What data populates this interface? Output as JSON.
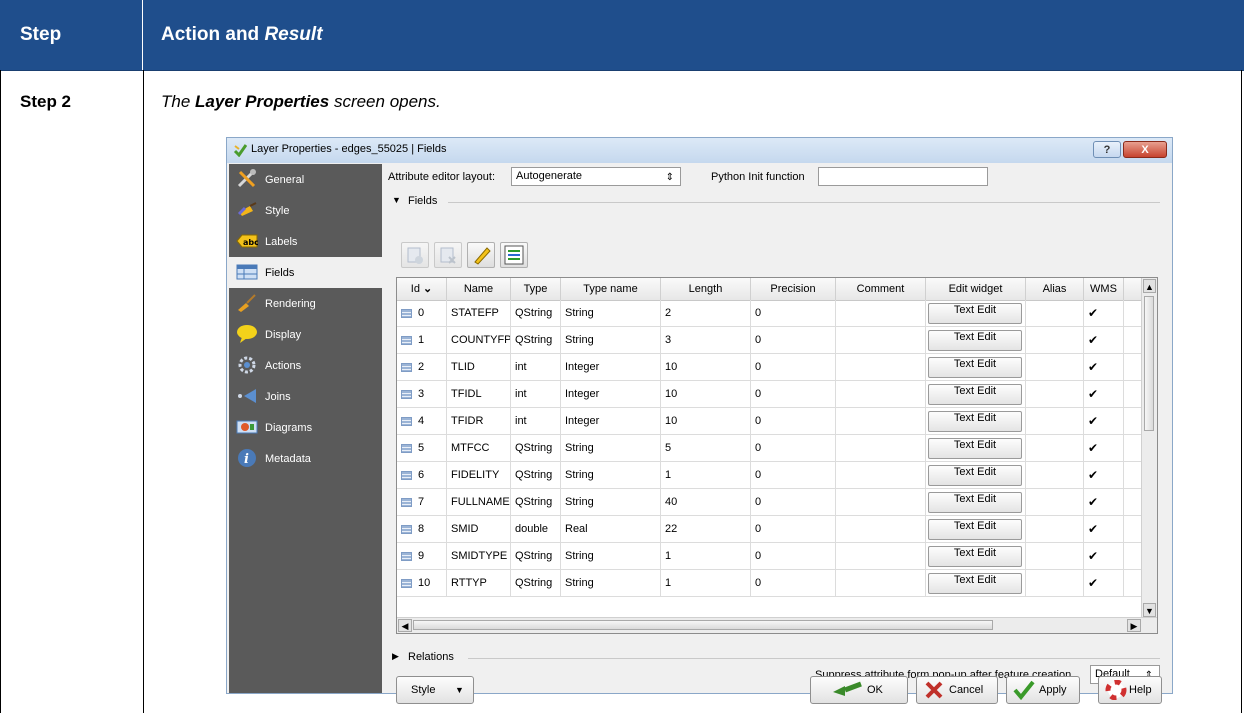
{
  "doc_table": {
    "header": {
      "col1": "Step",
      "col2_main": "Action and ",
      "col2_italic": "Result"
    },
    "row": {
      "step": "Step 2",
      "caption_pre": "The ",
      "caption_bold": "Layer Properties",
      "caption_post": " screen opens."
    }
  },
  "window": {
    "title": "Layer Properties - edges_55025 | Fields",
    "help_btn": "?",
    "close_btn": "X"
  },
  "sidebar": {
    "items": [
      {
        "label": "General",
        "icon": "tools-icon"
      },
      {
        "label": "Style",
        "icon": "style-brush-icon"
      },
      {
        "label": "Labels",
        "icon": "abc-labels-icon"
      },
      {
        "label": "Fields",
        "icon": "fields-table-icon"
      },
      {
        "label": "Rendering",
        "icon": "rendering-brush-icon"
      },
      {
        "label": "Display",
        "icon": "speech-bubble-icon"
      },
      {
        "label": "Actions",
        "icon": "gear-actions-icon"
      },
      {
        "label": "Joins",
        "icon": "joins-arrow-icon"
      },
      {
        "label": "Diagrams",
        "icon": "diagrams-icon"
      },
      {
        "label": "Metadata",
        "icon": "info-icon"
      }
    ],
    "active": "Fields"
  },
  "form": {
    "editor_layout_label": "Attribute editor layout:",
    "editor_layout_value": "Autogenerate",
    "python_init_label": "Python Init function",
    "python_init_value": "",
    "fields_group": "Fields",
    "relations_group": "Relations",
    "suppress_label": "Suppress attribute form pop-up after feature creation",
    "suppress_value": "Default"
  },
  "table": {
    "headers": [
      "Id",
      "Name",
      "Type",
      "Type name",
      "Length",
      "Precision",
      "Comment",
      "Edit widget",
      "Alias",
      "WMS"
    ],
    "rows": [
      {
        "id": "0",
        "name": "STATEFP",
        "type": "QString",
        "type_name": "String",
        "length": "2",
        "precision": "0",
        "comment": "",
        "widget": "Text Edit",
        "alias": "",
        "wms": "✔"
      },
      {
        "id": "1",
        "name": "COUNTYFP",
        "type": "QString",
        "type_name": "String",
        "length": "3",
        "precision": "0",
        "comment": "",
        "widget": "Text Edit",
        "alias": "",
        "wms": "✔"
      },
      {
        "id": "2",
        "name": "TLID",
        "type": "int",
        "type_name": "Integer",
        "length": "10",
        "precision": "0",
        "comment": "",
        "widget": "Text Edit",
        "alias": "",
        "wms": "✔"
      },
      {
        "id": "3",
        "name": "TFIDL",
        "type": "int",
        "type_name": "Integer",
        "length": "10",
        "precision": "0",
        "comment": "",
        "widget": "Text Edit",
        "alias": "",
        "wms": "✔"
      },
      {
        "id": "4",
        "name": "TFIDR",
        "type": "int",
        "type_name": "Integer",
        "length": "10",
        "precision": "0",
        "comment": "",
        "widget": "Text Edit",
        "alias": "",
        "wms": "✔"
      },
      {
        "id": "5",
        "name": "MTFCC",
        "type": "QString",
        "type_name": "String",
        "length": "5",
        "precision": "0",
        "comment": "",
        "widget": "Text Edit",
        "alias": "",
        "wms": "✔"
      },
      {
        "id": "6",
        "name": "FIDELITY",
        "type": "QString",
        "type_name": "String",
        "length": "1",
        "precision": "0",
        "comment": "",
        "widget": "Text Edit",
        "alias": "",
        "wms": "✔"
      },
      {
        "id": "7",
        "name": "FULLNAME",
        "type": "QString",
        "type_name": "String",
        "length": "40",
        "precision": "0",
        "comment": "",
        "widget": "Text Edit",
        "alias": "",
        "wms": "✔"
      },
      {
        "id": "8",
        "name": "SMID",
        "type": "double",
        "type_name": "Real",
        "length": "22",
        "precision": "0",
        "comment": "",
        "widget": "Text Edit",
        "alias": "",
        "wms": "✔"
      },
      {
        "id": "9",
        "name": "SMIDTYPE",
        "type": "QString",
        "type_name": "String",
        "length": "1",
        "precision": "0",
        "comment": "",
        "widget": "Text Edit",
        "alias": "",
        "wms": "✔"
      },
      {
        "id": "10",
        "name": "RTTYP",
        "type": "QString",
        "type_name": "String",
        "length": "1",
        "precision": "0",
        "comment": "",
        "widget": "Text Edit",
        "alias": "",
        "wms": "✔"
      }
    ]
  },
  "buttons": {
    "style": "Style",
    "ok": "OK",
    "cancel": "Cancel",
    "apply": "Apply",
    "help": "Help"
  },
  "colors": {
    "header_bg": "#1f4e8c",
    "sidebar_bg": "#5a5a5a"
  }
}
